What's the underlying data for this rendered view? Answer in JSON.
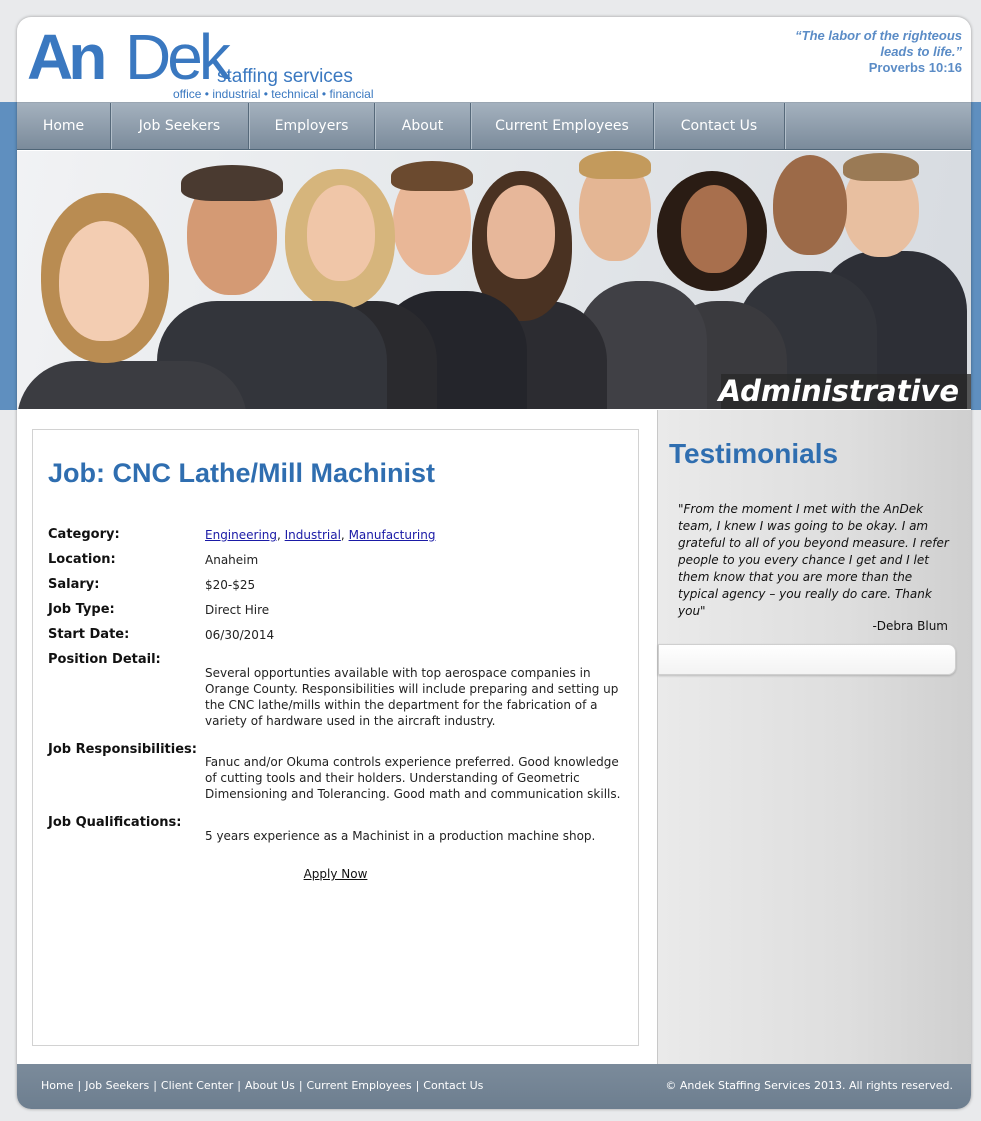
{
  "header": {
    "logo": {
      "an": "An",
      "dek": "Dek",
      "sub": "staffing services",
      "tagline": "office • industrial • technical • financial"
    },
    "quote_line1": "“The labor of the righteous",
    "quote_line2": "leads to life.”",
    "quote_ref": "Proverbs 10:16"
  },
  "nav": {
    "items": [
      {
        "label": "Home"
      },
      {
        "label": "Job Seekers"
      },
      {
        "label": "Employers"
      },
      {
        "label": "About"
      },
      {
        "label": "Current Employees"
      },
      {
        "label": "Contact Us"
      }
    ]
  },
  "hero": {
    "label": "Administrative"
  },
  "job": {
    "title": "Job: CNC Lathe/Mill Machinist",
    "category_label": "Category:",
    "category_links": [
      "Engineering",
      "Industrial",
      "Manufacturing"
    ],
    "location_label": "Location:",
    "location": "Anaheim",
    "salary_label": "Salary:",
    "salary": "$20-$25",
    "job_type_label": "Job Type:",
    "job_type": "Direct Hire",
    "start_date_label": "Start Date:",
    "start_date": "06/30/2014",
    "position_detail_label": "Position Detail:",
    "position_detail": "Several opportunties available with top aerospace companies in Orange County. Responsibilities will include preparing and setting up the CNC lathe/mills within the department for the fabrication of a variety of hardware used in the aircraft industry.",
    "responsibilities_label": "Job Responsibilities:",
    "responsibilities": "Fanuc and/or Okuma controls experience preferred. Good knowledge of cutting tools and their holders. Understanding of Geometric Dimensioning and Tolerancing. Good math and communication skills.",
    "qualifications_label": "Job Qualifications:",
    "qualifications": "5 years experience as a Machinist in a production machine shop.",
    "apply_label": "Apply Now"
  },
  "sidebar": {
    "title": "Testimonials",
    "quote": "\"From the moment I met with the AnDek team, I knew I was going to be okay. I am grateful to all of you beyond measure. I refer people to you every chance I get and I let them know that you are more than the typical agency – you really do care. Thank you\"",
    "author": "-Debra Blum"
  },
  "footer": {
    "links": [
      "Home",
      "Job Seekers",
      "Client Center",
      "About Us",
      "Current Employees",
      "Contact Us"
    ],
    "separator": "|",
    "copyright": "© Andek Staffing Services 2013. All rights reserved."
  },
  "colors": {
    "brand_blue": "#2f6eb0",
    "nav_gray": "#7b8b9b",
    "band_blue": "#5f8fbf"
  }
}
